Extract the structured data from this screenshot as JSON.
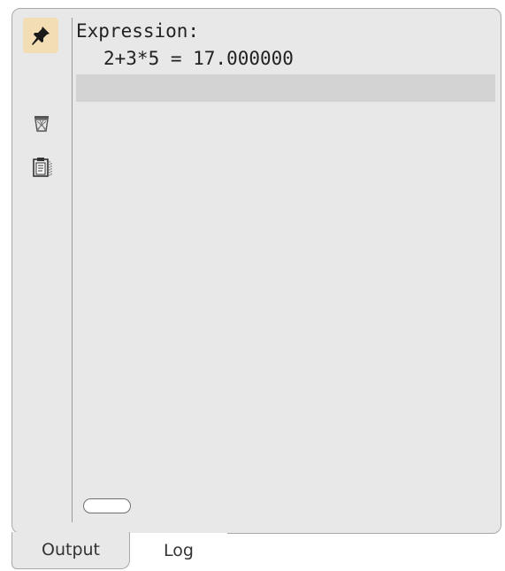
{
  "toolbar": {
    "pin_icon": "pin-icon",
    "trash_icon": "trash-icon",
    "clipboard_icon": "clipboard-icon",
    "active_color": "#f3ddb5"
  },
  "output": {
    "lines": [
      "Expression:",
      "2+3*5 = 17.000000"
    ],
    "input_value": ""
  },
  "tabs": [
    {
      "label": "Output",
      "active": true
    },
    {
      "label": "Log",
      "active": false
    }
  ]
}
